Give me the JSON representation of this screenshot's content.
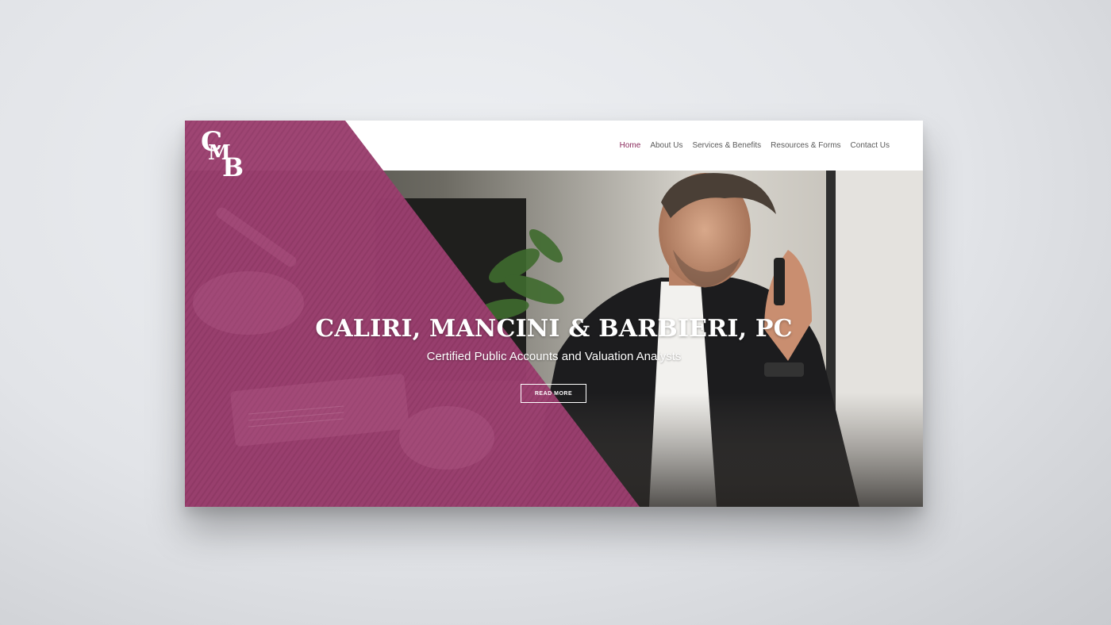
{
  "brand": {
    "logo_text": "CMB",
    "logo_letters": [
      "C",
      "M",
      "B"
    ]
  },
  "nav": {
    "items": [
      {
        "label": "Home",
        "active": true
      },
      {
        "label": "About Us",
        "active": false
      },
      {
        "label": "Services & Benefits",
        "active": false
      },
      {
        "label": "Resources & Forms",
        "active": false
      },
      {
        "label": "Contact Us",
        "active": false
      }
    ]
  },
  "hero": {
    "title": "CALIRI, MANCINI & BARBIERI, PC",
    "subtitle": "Certified Public Accounts and Valuation Analysts",
    "cta_label": "READ MORE"
  },
  "colors": {
    "accent": "#8a2a5c",
    "overlay": "#9b3f6f",
    "nav_text": "#5a5a5a",
    "hero_text": "#ffffff"
  },
  "icons": {
    "logo": "cmb-monogram-logo"
  }
}
